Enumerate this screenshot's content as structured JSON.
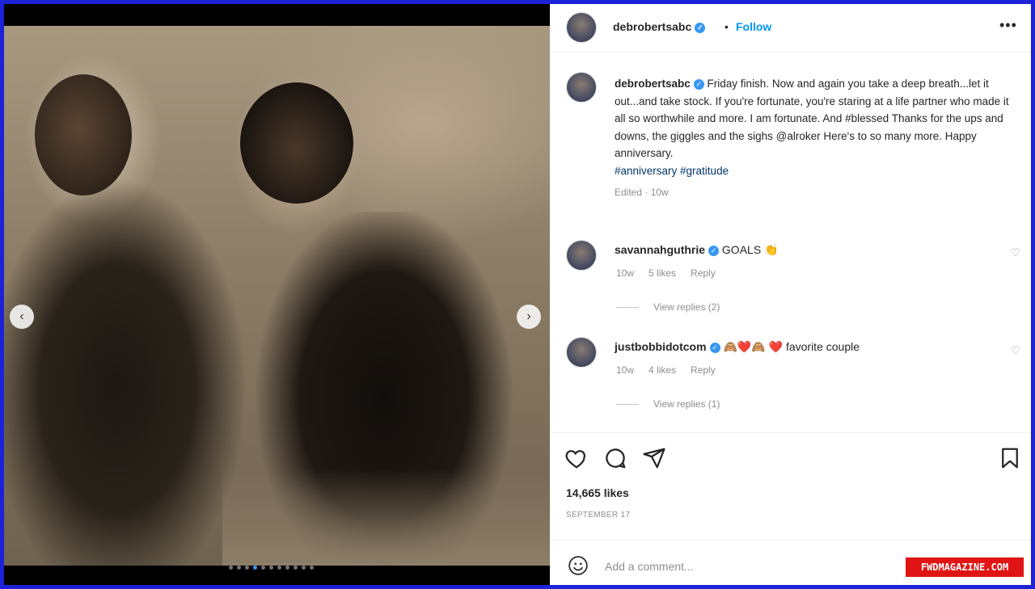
{
  "post": {
    "author": "debrobertsabc",
    "header_separator": "•",
    "follow_label": "Follow",
    "more_label": "•••",
    "caption_text": "Friday finish. Now and again you take a deep breath...let it out...and take stock. If you're fortunate, you're staring at a life partner who made it all so worthwhile and more. I am fortunate. And #blessed Thanks for the ups and downs, the giggles and the sighs @alroker Here's to so many more. Happy anniversary.",
    "caption_hashtags": "#anniversary #gratitude",
    "caption_meta": "Edited · 10w",
    "likes": "14,665 likes",
    "date": "SEPTEMBER 17",
    "add_comment_placeholder": "Add a comment...",
    "carousel": {
      "total_slides": 11,
      "active_index": 3
    }
  },
  "comments": [
    {
      "username": "savannahguthrie",
      "text": "GOALS 👏",
      "age": "10w",
      "likes": "5 likes",
      "reply_label": "Reply",
      "view_replies": "View replies (2)"
    },
    {
      "username": "justbobbidotcom",
      "text": "🙈❤️🙈 ❤️ favorite couple",
      "age": "10w",
      "likes": "4 likes",
      "reply_label": "Reply",
      "view_replies": "View replies (1)"
    }
  ],
  "icons": {
    "verified": "verified-check-icon",
    "like": "heart-icon",
    "comment": "comment-bubble-icon",
    "share": "paper-plane-icon",
    "save": "bookmark-icon",
    "emoji": "smiley-icon",
    "prev": "chevron-left-icon",
    "next": "chevron-right-icon"
  },
  "colors": {
    "frame": "#1d22d6",
    "accent": "#0095f6",
    "verified": "#3897f0",
    "watermark_bg": "#e01414"
  },
  "watermark": "FWDMAGAZINE.COM"
}
